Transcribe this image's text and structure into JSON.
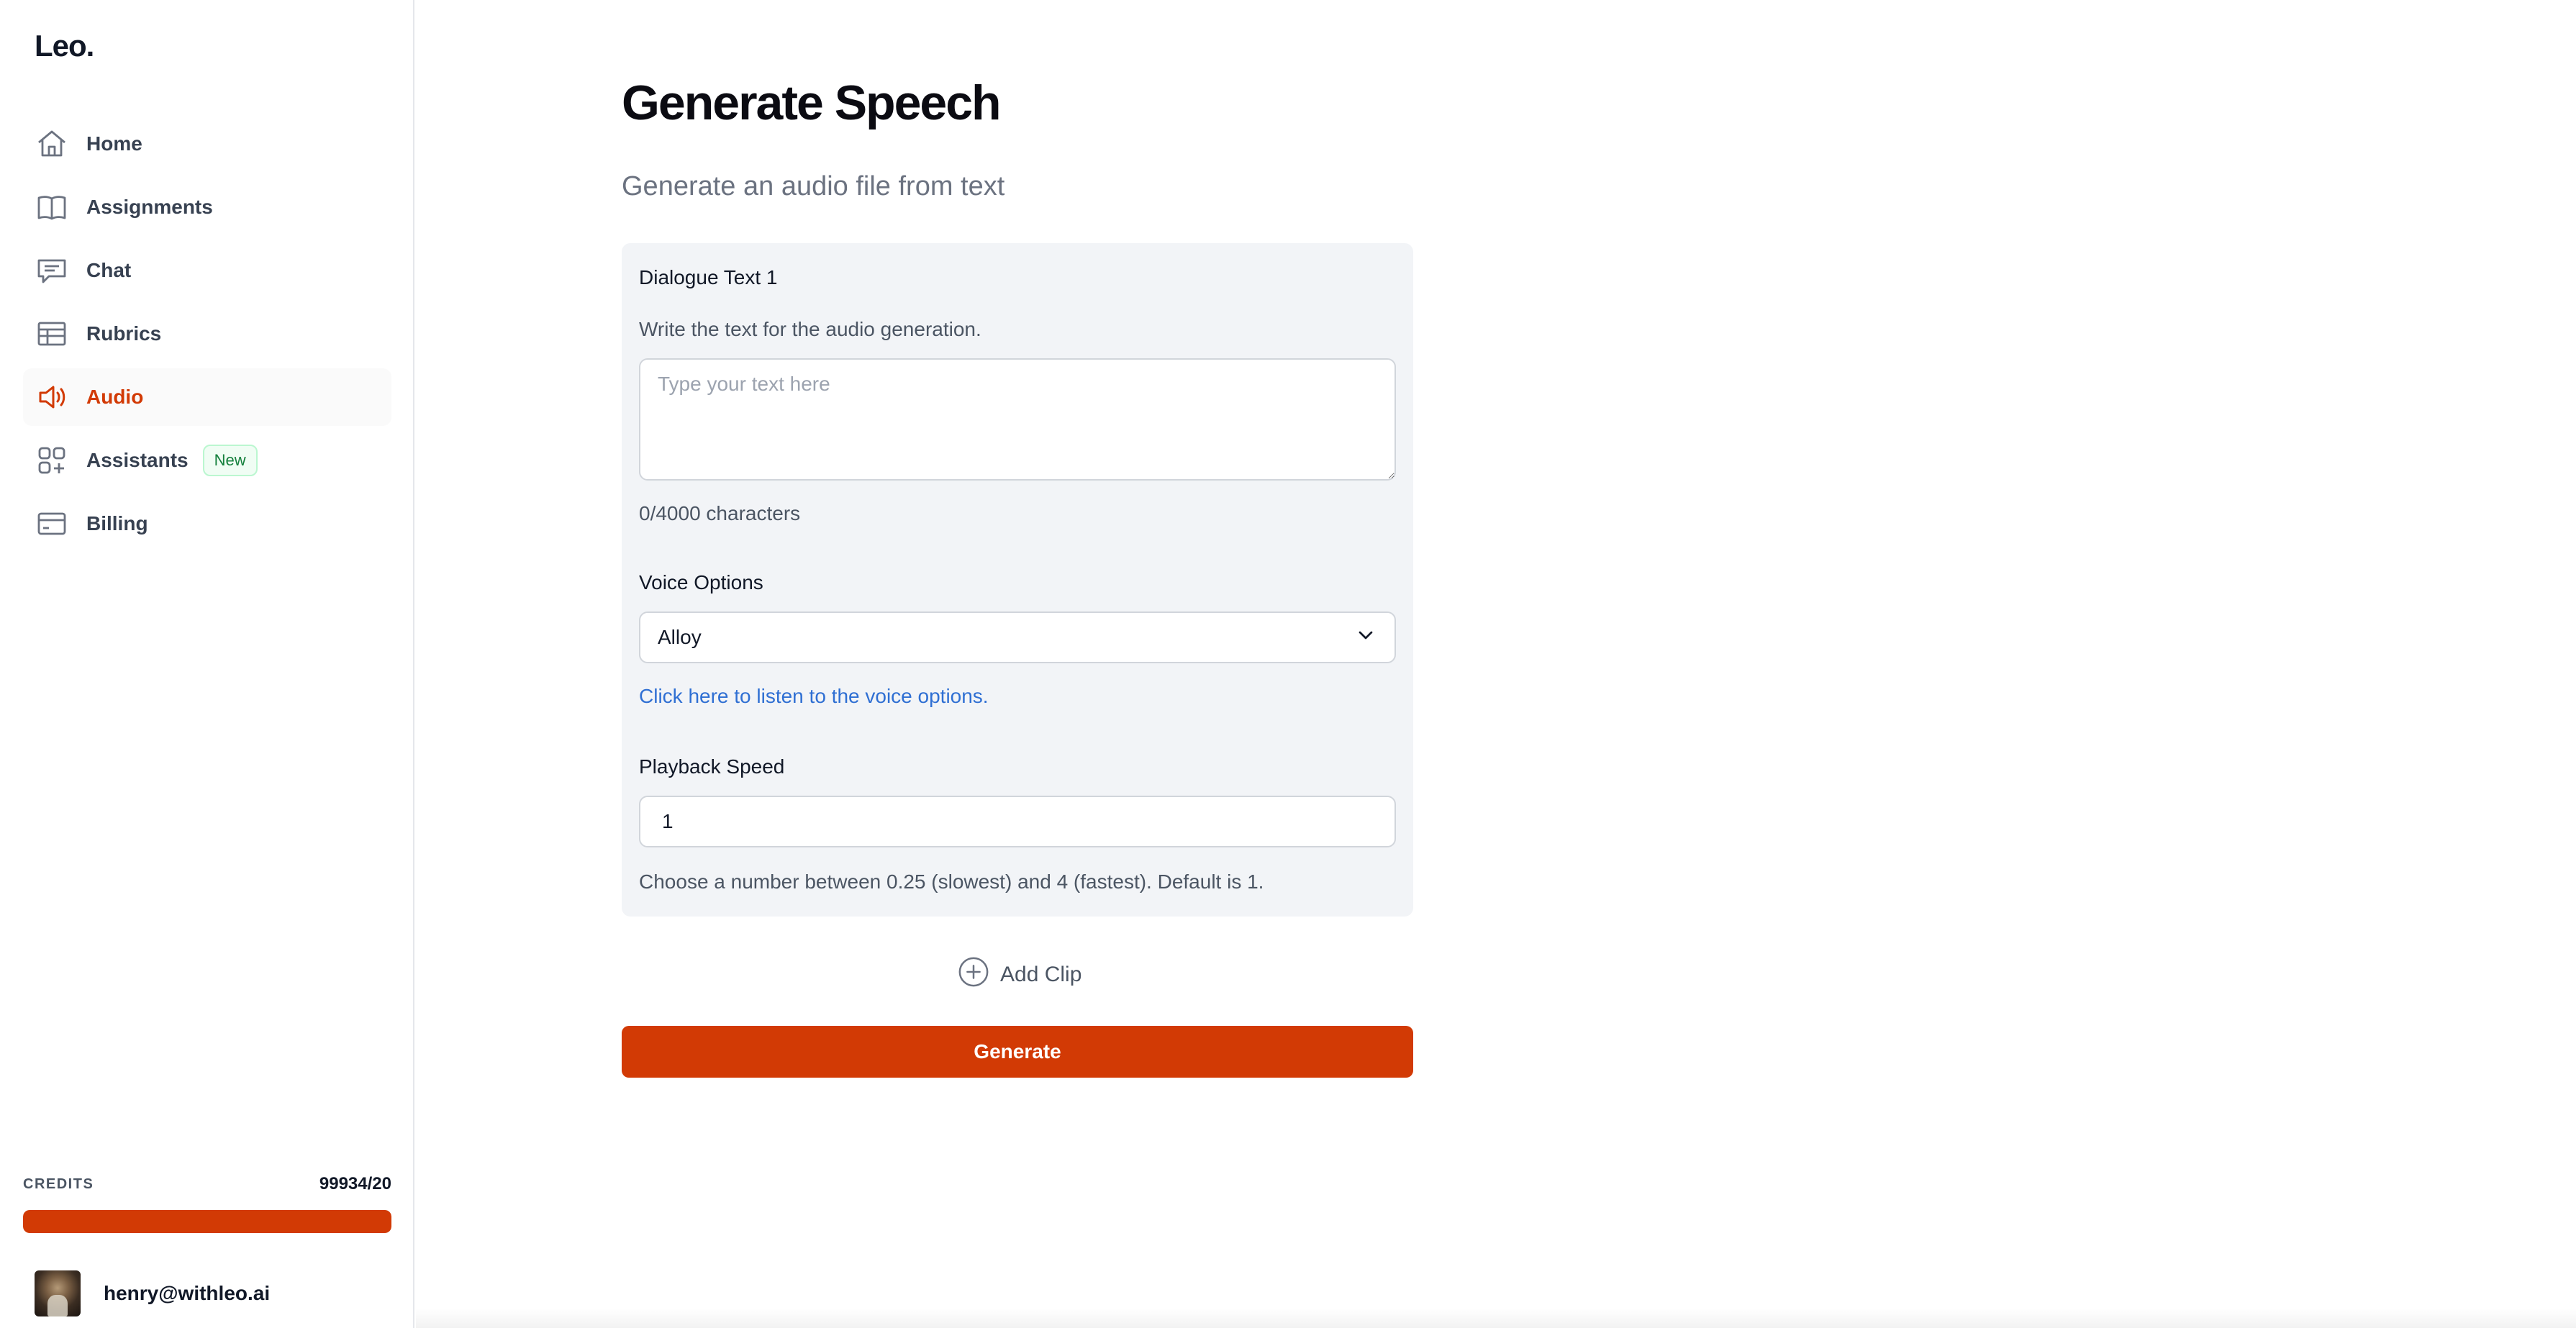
{
  "app": {
    "logo": "Leo."
  },
  "sidebar": {
    "items": [
      {
        "label": "Home",
        "icon": "home-icon",
        "active": false
      },
      {
        "label": "Assignments",
        "icon": "book-icon",
        "active": false
      },
      {
        "label": "Chat",
        "icon": "chat-icon",
        "active": false
      },
      {
        "label": "Rubrics",
        "icon": "table-icon",
        "active": false
      },
      {
        "label": "Audio",
        "icon": "speaker-icon",
        "active": true
      },
      {
        "label": "Assistants",
        "icon": "grid-plus-icon",
        "active": false,
        "badge": "New"
      },
      {
        "label": "Billing",
        "icon": "credit-card-icon",
        "active": false
      }
    ],
    "credits": {
      "label": "CREDITS",
      "value": "99934/20",
      "fill_percent": 100
    },
    "user": {
      "email": "henry@withleo.ai"
    }
  },
  "main": {
    "title": "Generate Speech",
    "subtitle": "Generate an audio file from text",
    "dialogue": {
      "label": "Dialogue Text 1",
      "helper": "Write the text for the audio generation.",
      "placeholder": "Type your text here",
      "value": "",
      "counter": "0/4000 characters"
    },
    "voice": {
      "label": "Voice Options",
      "selected": "Alloy",
      "link": "Click here to listen to the voice options."
    },
    "speed": {
      "label": "Playback Speed",
      "value": "1",
      "helper": "Choose a number between 0.25 (slowest) and 4 (fastest). Default is 1."
    },
    "add_clip": "Add Clip",
    "generate": "Generate"
  },
  "colors": {
    "accent": "#d23a05",
    "link": "#2f6fd3",
    "card_bg": "#f2f4f7",
    "badge_green": "#15803d"
  }
}
